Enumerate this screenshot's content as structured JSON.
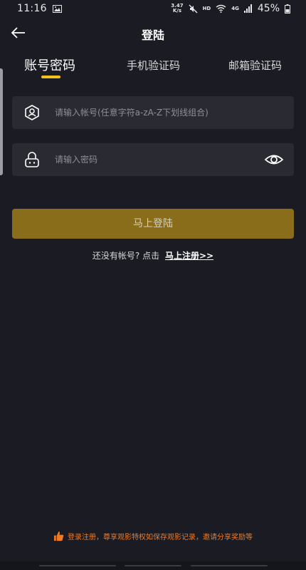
{
  "status_bar": {
    "time": "11:16",
    "net_speed_value": "3.47",
    "net_speed_unit": "K/s",
    "hd_label": "HD",
    "net_type": "4G",
    "battery": "45%"
  },
  "header": {
    "title": "登陆"
  },
  "tabs": [
    {
      "label": "账号密码",
      "active": true
    },
    {
      "label": "手机验证码",
      "active": false
    },
    {
      "label": "邮箱验证码",
      "active": false
    }
  ],
  "form": {
    "account_placeholder": "请输入帐号(任意字符a-zA-Z下划线组合)",
    "account_value": "",
    "password_placeholder": "请输入密码",
    "password_value": ""
  },
  "login_button": {
    "label": "马上登陆"
  },
  "register": {
    "prompt": "还没有帐号? 点击",
    "link": "马上注册>>"
  },
  "promo": {
    "text": "登录注册，尊享观影特权如保存观影记录，邀请分享奖励等"
  },
  "colors": {
    "background": "#1a1b23",
    "input_bg": "#2a2b32",
    "accent": "#f2c21a",
    "button": "#8a6d1a",
    "promo": "#ee7a24"
  },
  "icons": {
    "back": "back-arrow-icon",
    "account": "user-shield-icon",
    "password": "lock-icon",
    "visibility": "eye-icon",
    "promo": "thumbs-up-icon"
  }
}
